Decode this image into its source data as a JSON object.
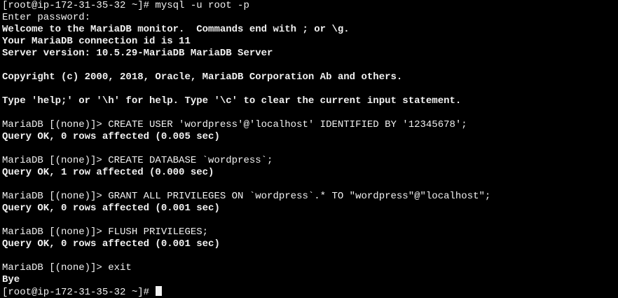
{
  "terminal": {
    "lines": [
      {
        "type": "prompt",
        "text": "[root@ip-172-31-35-32 ~]# mysql -u root -p"
      },
      {
        "type": "plain",
        "text": "Enter password:"
      },
      {
        "type": "output",
        "text": "Welcome to the MariaDB monitor.  Commands end with ; or \\g."
      },
      {
        "type": "output",
        "text": "Your MariaDB connection id is 11"
      },
      {
        "type": "output",
        "text": "Server version: 10.5.29-MariaDB MariaDB Server"
      },
      {
        "type": "blank",
        "text": ""
      },
      {
        "type": "output",
        "text": "Copyright (c) 2000, 2018, Oracle, MariaDB Corporation Ab and others."
      },
      {
        "type": "blank",
        "text": ""
      },
      {
        "type": "output",
        "text": "Type 'help;' or '\\h' for help. Type '\\c' to clear the current input statement."
      },
      {
        "type": "blank",
        "text": ""
      },
      {
        "type": "command",
        "text": "MariaDB [(none)]> CREATE USER 'wordpress'@'localhost' IDENTIFIED BY '12345678';"
      },
      {
        "type": "output",
        "text": "Query OK, 0 rows affected (0.005 sec)"
      },
      {
        "type": "blank",
        "text": ""
      },
      {
        "type": "command",
        "text": "MariaDB [(none)]> CREATE DATABASE `wordpress`;"
      },
      {
        "type": "output",
        "text": "Query OK, 1 row affected (0.000 sec)"
      },
      {
        "type": "blank",
        "text": ""
      },
      {
        "type": "command",
        "text": "MariaDB [(none)]> GRANT ALL PRIVILEGES ON `wordpress`.* TO \"wordpress\"@\"localhost\";"
      },
      {
        "type": "output",
        "text": "Query OK, 0 rows affected (0.001 sec)"
      },
      {
        "type": "blank",
        "text": ""
      },
      {
        "type": "command",
        "text": "MariaDB [(none)]> FLUSH PRIVILEGES;"
      },
      {
        "type": "output",
        "text": "Query OK, 0 rows affected (0.001 sec)"
      },
      {
        "type": "blank",
        "text": ""
      },
      {
        "type": "command",
        "text": "MariaDB [(none)]> exit"
      },
      {
        "type": "output",
        "text": "Bye"
      },
      {
        "type": "final_prompt",
        "text": "[root@ip-172-31-35-32 ~]# "
      }
    ]
  },
  "colors": {
    "background": "#000000",
    "foreground": "#f2f2f2"
  }
}
